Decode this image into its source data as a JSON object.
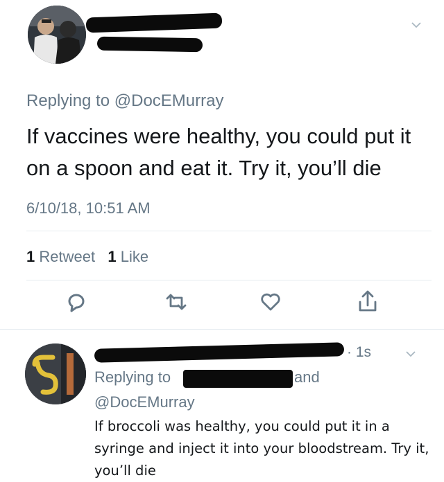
{
  "tweet": {
    "replying_prefix": "Replying to ",
    "replying_handle": "@DocEMurray",
    "text": "If vaccines were healthy, you could put it on a spoon and eat it. Try it, you’ll die",
    "timestamp": "6/10/18, 10:51 AM",
    "retweet_count": "1",
    "retweet_label": " Retweet",
    "like_count": "1",
    "like_label": " Like"
  },
  "actions": [
    "reply-icon",
    "retweet-icon",
    "like-icon",
    "share-icon"
  ],
  "reply": {
    "time": "· 1s",
    "replying_prefix": "Replying to",
    "and_label": "and",
    "handle": "@DocEMurray",
    "text": "If broccoli was healthy, you could put it in a syringe and inject it into your bloodstream. Try it, you’ll die"
  },
  "colors": {
    "text": "#14171a",
    "muted": "#657786",
    "divider": "#e6ecf0",
    "redaction": "#0b0b0b"
  }
}
